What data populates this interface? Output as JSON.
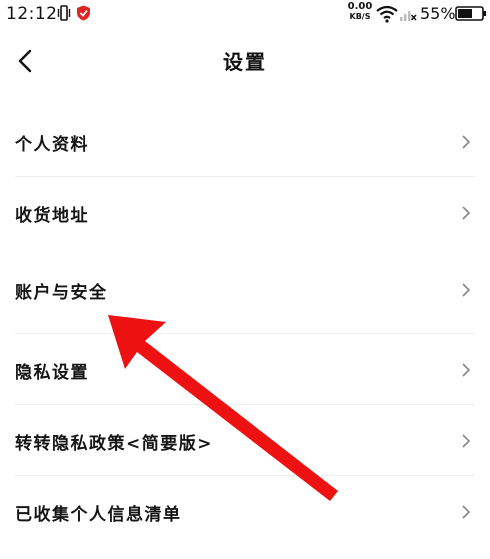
{
  "status_bar": {
    "time": "12:12",
    "net_speed_value": "0.00",
    "net_speed_unit": "KB/S",
    "battery_percent": "55%"
  },
  "header": {
    "title": "设置"
  },
  "settings": {
    "items": [
      {
        "label": "个人资料"
      },
      {
        "label": "收货地址"
      },
      {
        "label": "账户与安全"
      },
      {
        "label": "隐私设置"
      },
      {
        "label": "转转隐私政策<简要版>"
      },
      {
        "label": "已收集个人信息清单"
      }
    ]
  },
  "colors": {
    "annotation_arrow": "#ee1111",
    "divider": "#ededed",
    "chevron": "#888888",
    "text": "#151515"
  }
}
